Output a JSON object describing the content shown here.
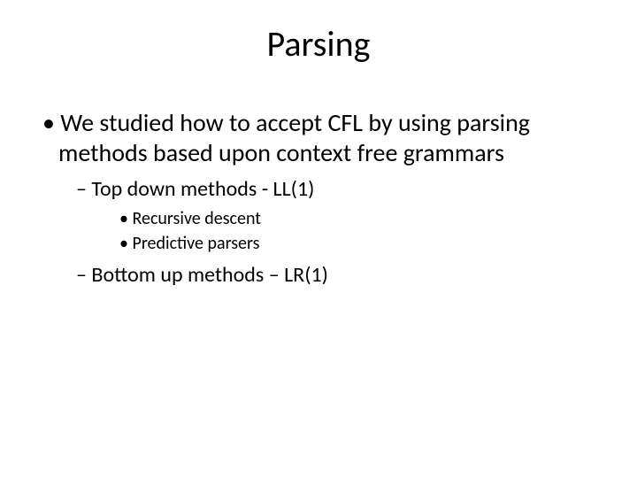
{
  "title": "Parsing",
  "bullets": {
    "l1_1": "We studied how to accept CFL by using parsing methods based upon context free grammars",
    "l2_1": "Top down methods  -  LL(1)",
    "l3_1": "Recursive descent",
    "l3_2": "Predictive parsers",
    "l2_2": "Bottom up methods – LR(1)"
  }
}
